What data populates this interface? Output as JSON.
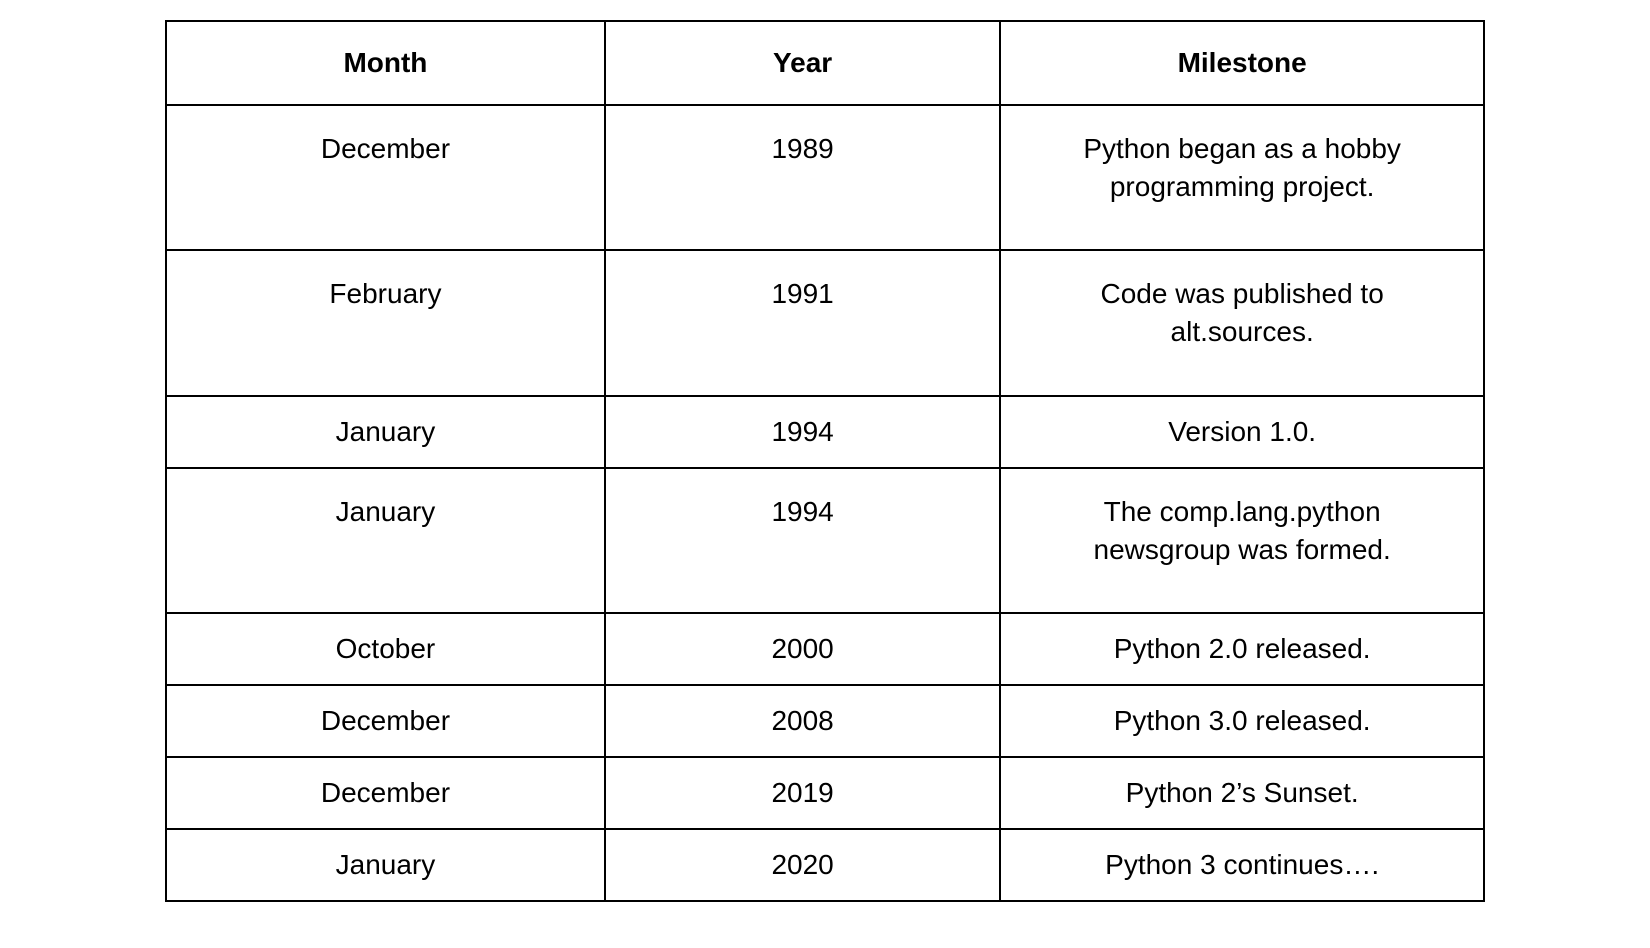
{
  "chart_data": {
    "type": "table",
    "columns": [
      "Month",
      "Year",
      "Milestone"
    ],
    "rows": [
      [
        "December",
        "1989",
        "Python began as a hobby programming project."
      ],
      [
        "February",
        "1991",
        "Code was published to alt.sources."
      ],
      [
        "January",
        "1994",
        "Version 1.0."
      ],
      [
        "January",
        "1994",
        "The comp.lang.python newsgroup was formed."
      ],
      [
        "October",
        "2000",
        "Python 2.0 released."
      ],
      [
        "December",
        "2008",
        "Python 3.0 released."
      ],
      [
        "December",
        "2019",
        "Python 2’s Sunset."
      ],
      [
        "January",
        "2020",
        "Python 3 continues…."
      ]
    ]
  },
  "table": {
    "headers": {
      "month": "Month",
      "year": "Year",
      "milestone": "Milestone"
    },
    "rows": [
      {
        "month": "December",
        "year": "1989",
        "milestone": "Python began as a hobby programming project.",
        "tall": true
      },
      {
        "month": "February",
        "year": "1991",
        "milestone": "Code was published to alt.sources.",
        "tall": true
      },
      {
        "month": "January",
        "year": "1994",
        "milestone": "Version 1.0.",
        "tall": false
      },
      {
        "month": "January",
        "year": "1994",
        "milestone": "The comp.lang.python newsgroup was formed.",
        "tall": true
      },
      {
        "month": "October",
        "year": "2000",
        "milestone": "Python 2.0 released.",
        "tall": false
      },
      {
        "month": "December",
        "year": "2008",
        "milestone": "Python 3.0 released.",
        "tall": false
      },
      {
        "month": "December",
        "year": "2019",
        "milestone": "Python 2’s Sunset.",
        "tall": false
      },
      {
        "month": "January",
        "year": "2020",
        "milestone": "Python 3 continues….",
        "tall": false
      }
    ]
  }
}
